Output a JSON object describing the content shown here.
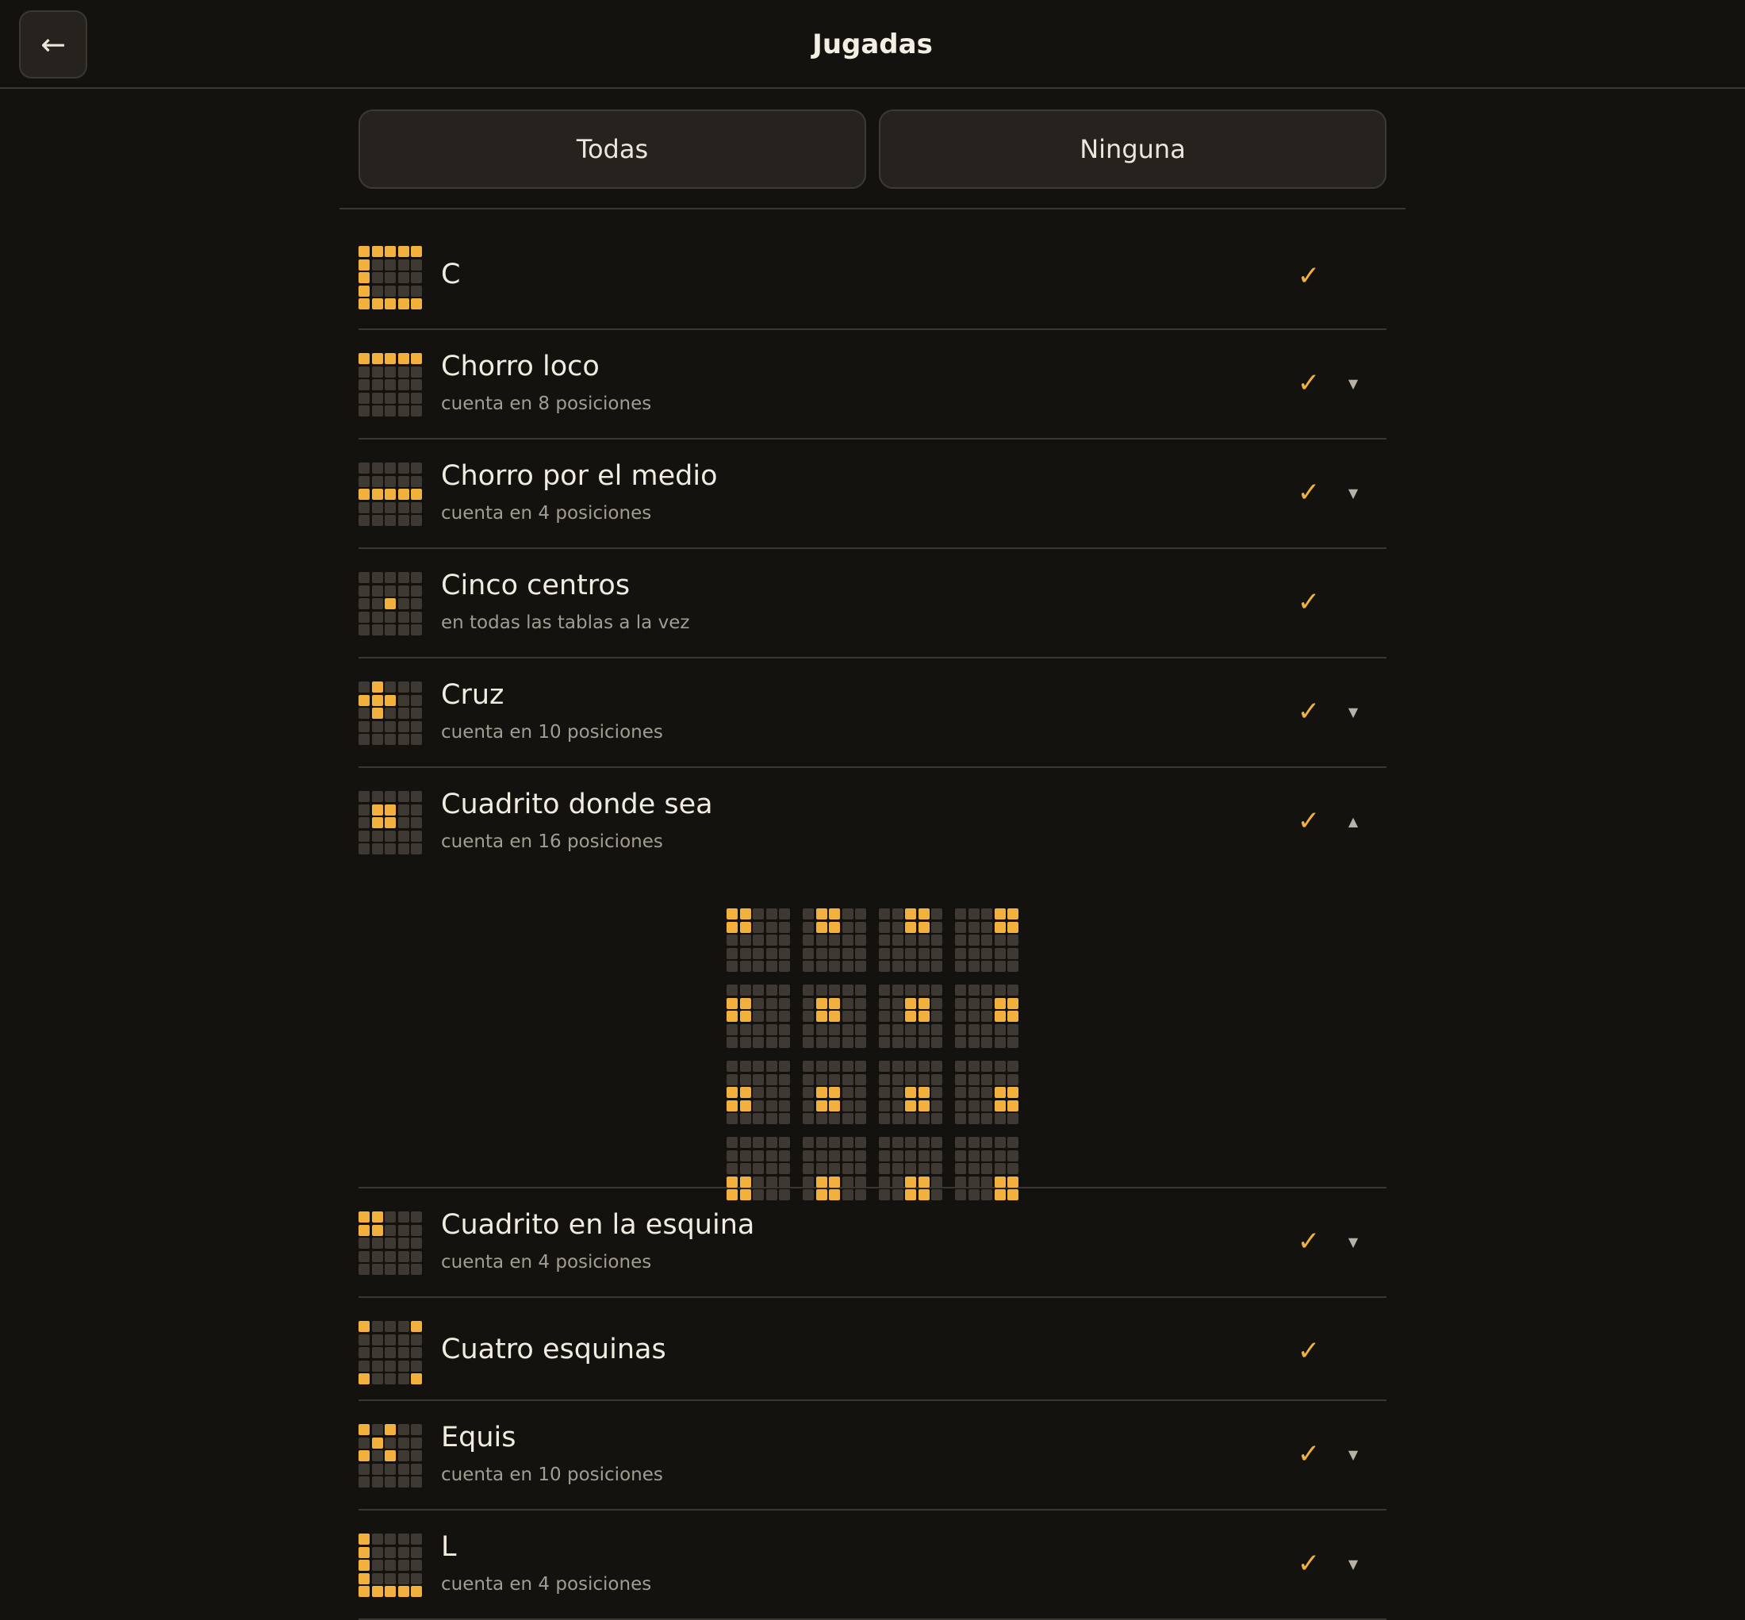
{
  "header": {
    "back_icon": "←",
    "title": "Jugadas"
  },
  "actions": {
    "all_label": "Todas",
    "none_label": "Ninguna"
  },
  "icons": {
    "check": "✓",
    "expand": "▼",
    "collapse": "▲"
  },
  "colors": {
    "accent": "#f2b13c",
    "cell_off": "#3e3a33",
    "background": "#13120f"
  },
  "plays": [
    {
      "name": "C",
      "subtitle": "",
      "selected": true,
      "expandable": false,
      "expanded": false,
      "cells": [
        [
          1,
          1,
          1,
          1,
          1
        ],
        [
          1,
          0,
          0,
          0,
          0
        ],
        [
          1,
          0,
          0,
          0,
          0
        ],
        [
          1,
          0,
          0,
          0,
          0
        ],
        [
          1,
          1,
          1,
          1,
          1
        ]
      ]
    },
    {
      "name": "Chorro loco",
      "subtitle": "cuenta en 8 posiciones",
      "selected": true,
      "expandable": true,
      "expanded": false,
      "cells": [
        [
          1,
          1,
          1,
          1,
          1
        ],
        [
          0,
          0,
          0,
          0,
          0
        ],
        [
          0,
          0,
          0,
          0,
          0
        ],
        [
          0,
          0,
          0,
          0,
          0
        ],
        [
          0,
          0,
          0,
          0,
          0
        ]
      ]
    },
    {
      "name": "Chorro por el medio",
      "subtitle": "cuenta en 4 posiciones",
      "selected": true,
      "expandable": true,
      "expanded": false,
      "cells": [
        [
          0,
          0,
          0,
          0,
          0
        ],
        [
          0,
          0,
          0,
          0,
          0
        ],
        [
          1,
          1,
          1,
          1,
          1
        ],
        [
          0,
          0,
          0,
          0,
          0
        ],
        [
          0,
          0,
          0,
          0,
          0
        ]
      ]
    },
    {
      "name": "Cinco centros",
      "subtitle": "en todas las tablas a la vez",
      "selected": true,
      "expandable": false,
      "expanded": false,
      "cells": [
        [
          0,
          0,
          0,
          0,
          0
        ],
        [
          0,
          0,
          0,
          0,
          0
        ],
        [
          0,
          0,
          1,
          0,
          0
        ],
        [
          0,
          0,
          0,
          0,
          0
        ],
        [
          0,
          0,
          0,
          0,
          0
        ]
      ]
    },
    {
      "name": "Cruz",
      "subtitle": "cuenta en 10 posiciones",
      "selected": true,
      "expandable": true,
      "expanded": false,
      "cells": [
        [
          0,
          1,
          0,
          0,
          0
        ],
        [
          1,
          1,
          1,
          0,
          0
        ],
        [
          0,
          1,
          0,
          0,
          0
        ],
        [
          0,
          0,
          0,
          0,
          0
        ],
        [
          0,
          0,
          0,
          0,
          0
        ]
      ]
    },
    {
      "name": "Cuadrito donde sea",
      "subtitle": "cuenta en 16 posiciones",
      "selected": true,
      "expandable": true,
      "expanded": true,
      "cells": [
        [
          0,
          0,
          0,
          0,
          0
        ],
        [
          0,
          1,
          1,
          0,
          0
        ],
        [
          0,
          1,
          1,
          0,
          0
        ],
        [
          0,
          0,
          0,
          0,
          0
        ],
        [
          0,
          0,
          0,
          0,
          0
        ]
      ],
      "positions": [
        {
          "row": 0,
          "col": 0
        },
        {
          "row": 0,
          "col": 1
        },
        {
          "row": 0,
          "col": 2
        },
        {
          "row": 0,
          "col": 3
        },
        {
          "row": 1,
          "col": 0
        },
        {
          "row": 1,
          "col": 1
        },
        {
          "row": 1,
          "col": 2
        },
        {
          "row": 1,
          "col": 3
        },
        {
          "row": 2,
          "col": 0
        },
        {
          "row": 2,
          "col": 1
        },
        {
          "row": 2,
          "col": 2
        },
        {
          "row": 2,
          "col": 3
        },
        {
          "row": 3,
          "col": 0
        },
        {
          "row": 3,
          "col": 1
        },
        {
          "row": 3,
          "col": 2
        },
        {
          "row": 3,
          "col": 3
        }
      ]
    },
    {
      "name": "Cuadrito en la esquina",
      "subtitle": "cuenta en 4 posiciones",
      "selected": true,
      "expandable": true,
      "expanded": false,
      "cells": [
        [
          1,
          1,
          0,
          0,
          0
        ],
        [
          1,
          1,
          0,
          0,
          0
        ],
        [
          0,
          0,
          0,
          0,
          0
        ],
        [
          0,
          0,
          0,
          0,
          0
        ],
        [
          0,
          0,
          0,
          0,
          0
        ]
      ]
    },
    {
      "name": "Cuatro esquinas",
      "subtitle": "",
      "selected": true,
      "expandable": false,
      "expanded": false,
      "cells": [
        [
          1,
          0,
          0,
          0,
          1
        ],
        [
          0,
          0,
          0,
          0,
          0
        ],
        [
          0,
          0,
          0,
          0,
          0
        ],
        [
          0,
          0,
          0,
          0,
          0
        ],
        [
          1,
          0,
          0,
          0,
          1
        ]
      ]
    },
    {
      "name": "Equis",
      "subtitle": "cuenta en 10 posiciones",
      "selected": true,
      "expandable": true,
      "expanded": false,
      "cells": [
        [
          1,
          0,
          1,
          0,
          0
        ],
        [
          0,
          1,
          0,
          0,
          0
        ],
        [
          1,
          0,
          1,
          0,
          0
        ],
        [
          0,
          0,
          0,
          0,
          0
        ],
        [
          0,
          0,
          0,
          0,
          0
        ]
      ]
    },
    {
      "name": "L",
      "subtitle": "cuenta en 4 posiciones",
      "selected": true,
      "expandable": true,
      "expanded": false,
      "cells": [
        [
          1,
          0,
          0,
          0,
          0
        ],
        [
          1,
          0,
          0,
          0,
          0
        ],
        [
          1,
          0,
          0,
          0,
          0
        ],
        [
          1,
          0,
          0,
          0,
          0
        ],
        [
          1,
          1,
          1,
          1,
          1
        ]
      ]
    }
  ]
}
